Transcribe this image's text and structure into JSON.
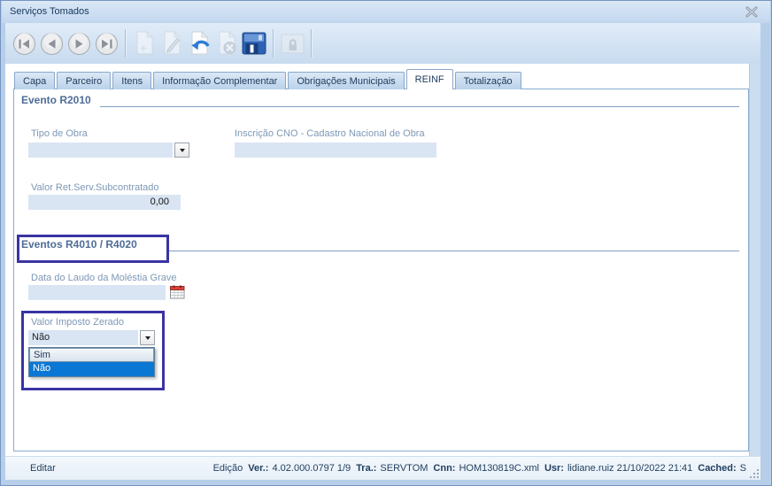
{
  "window": {
    "title": "Serviços Tomados"
  },
  "toolbar": {
    "buttons": [
      "first-record",
      "previous-record",
      "next-record",
      "last-record",
      "new",
      "edit",
      "undo",
      "cancel",
      "save",
      "lock"
    ]
  },
  "tabs": [
    {
      "label": "Capa",
      "active": false
    },
    {
      "label": "Parceiro",
      "active": false
    },
    {
      "label": "Itens",
      "active": false
    },
    {
      "label": "Informação Complementar",
      "active": false
    },
    {
      "label": "Obrigações Municipais",
      "active": false
    },
    {
      "label": "REINF",
      "active": true
    },
    {
      "label": "Totalização",
      "active": false
    }
  ],
  "sections": {
    "r2010": {
      "title": "Evento R2010"
    },
    "r4010": {
      "title": "Eventos R4010 / R4020"
    }
  },
  "fields": {
    "tipo_obra": {
      "label": "Tipo de Obra",
      "value": ""
    },
    "inscricao_cno": {
      "label": "Inscrição CNO - Cadastro Nacional de Obra",
      "value": ""
    },
    "valor_ret": {
      "label": "Valor Ret.Serv.Subcontratado",
      "value": "0,00"
    },
    "data_laudo": {
      "label": "Data do Laudo da Moléstia Grave",
      "value": ""
    },
    "valor_imposto": {
      "label": "Valor Imposto Zerado",
      "value": "Não",
      "options": [
        "Sim",
        "Não"
      ],
      "selected_option": "Não"
    }
  },
  "statusbar": {
    "mode": "Editar",
    "edition": "Edição",
    "entries": [
      {
        "key": "Ver.:",
        "value": "4.02.000.0797 1/9"
      },
      {
        "key": "Tra.:",
        "value": "SERVTOM"
      },
      {
        "key": "Cnn:",
        "value": "HOM130819C.xml"
      },
      {
        "key": "Usr:",
        "value": "lidiane.ruiz 21/10/2022 21:41"
      },
      {
        "key": "Cached:",
        "value": "S"
      }
    ]
  },
  "colors": {
    "annotation": "#3a34a3",
    "selection_blue": "#0b77d4",
    "input_bg": "#d9e5f3",
    "frame_blue": "#b7cee9"
  }
}
